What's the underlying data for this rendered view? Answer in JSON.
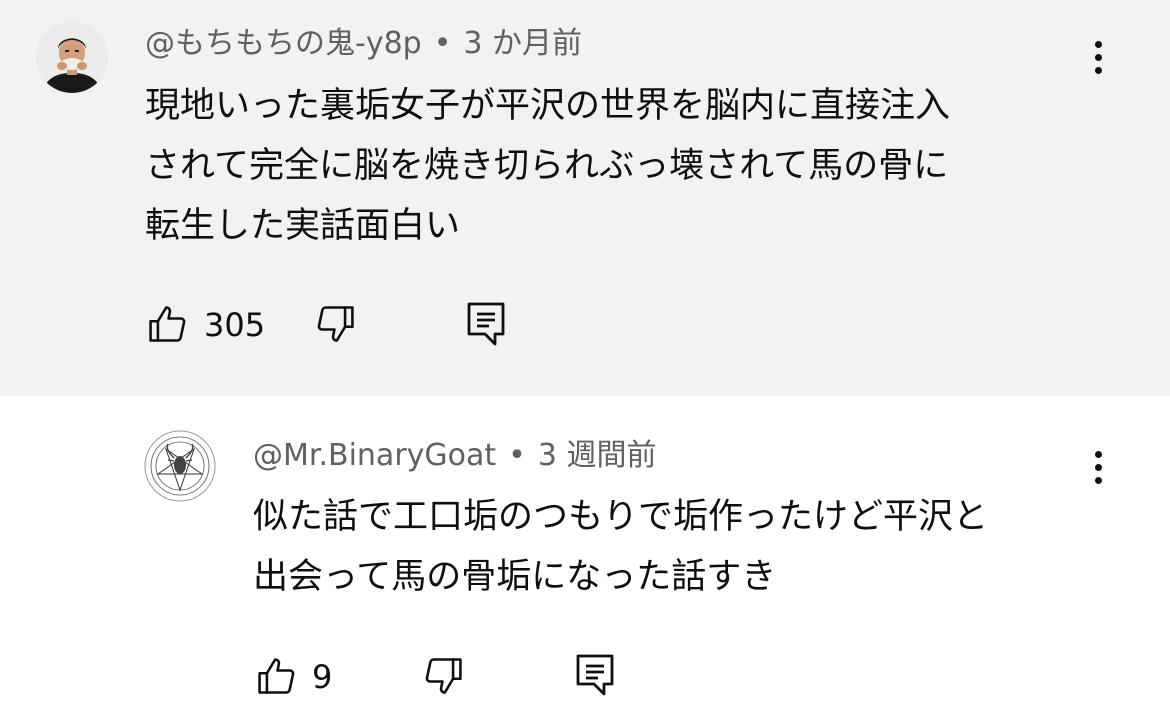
{
  "comments": [
    {
      "author": "@もちもちの鬼-y8p",
      "time": "3 か月前",
      "separator": "•",
      "lines": [
        "現地いった裏垢女子が平沢の世界を脳内に直接注入",
        "されて完全に脳を焼き切られぶっ壊されて馬の骨に",
        "転生した実話面白い"
      ],
      "likes": "305",
      "avatar_icon": "person-avatar",
      "highlighted": true
    },
    {
      "author": "@Mr.BinaryGoat",
      "time": "3 週間前",
      "separator": "•",
      "lines": [
        "似た話で工口垢のつもりで垢作ったけど平沢と",
        "出会って馬の骨垢になった話すき"
      ],
      "likes": "9",
      "avatar_icon": "pentagram-goat-avatar",
      "highlighted": false
    }
  ],
  "colors": {
    "highlight_bg": "#f2f2f2",
    "text_primary": "#0f0f0f",
    "text_secondary": "#606060"
  },
  "icons": [
    "thumbs-up-icon",
    "thumbs-down-icon",
    "reply-icon",
    "more-vert-icon"
  ]
}
